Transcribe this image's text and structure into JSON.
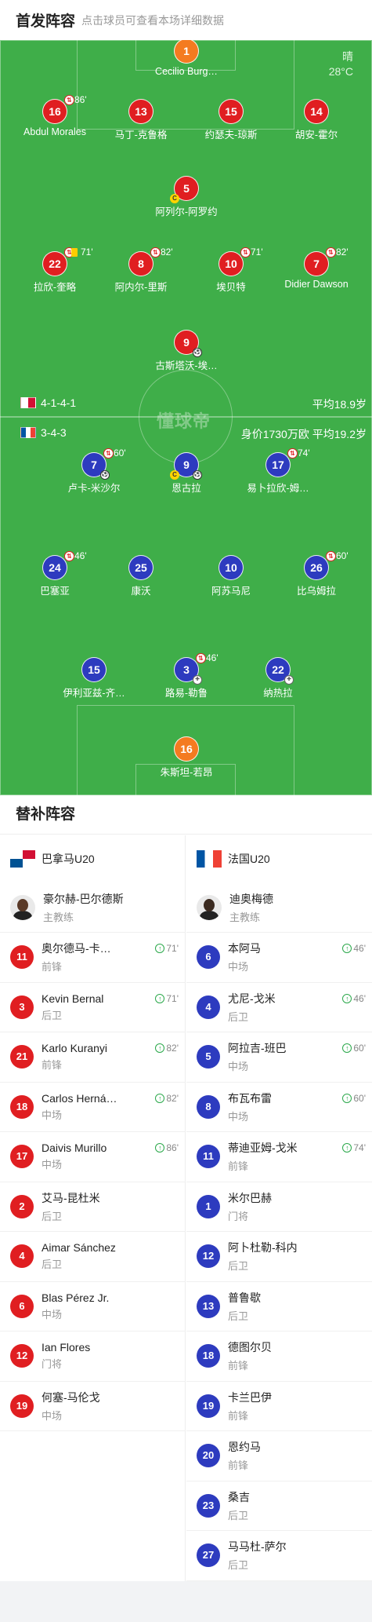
{
  "header": {
    "title": "首发阵容",
    "hint": "点击球员可查看本场详细数据"
  },
  "weather": {
    "condition": "晴",
    "temperature": "28°C"
  },
  "watermark": "懂球帝",
  "home_team": {
    "formation": "4-1-4-1",
    "info": "平均18.9岁",
    "players": [
      {
        "number": "1",
        "name": "Cecilio Burg…",
        "color": "orange"
      },
      {
        "number": "16",
        "name": "Abdul Morales",
        "sub": "86'",
        "color": "red"
      },
      {
        "number": "13",
        "name": "马丁-克鲁格",
        "color": "red"
      },
      {
        "number": "15",
        "name": "约瑟夫-琼斯",
        "color": "red"
      },
      {
        "number": "14",
        "name": "胡安-霍尔",
        "color": "red"
      },
      {
        "number": "5",
        "name": "阿列尔-阿罗约",
        "color": "red",
        "captain": "C"
      },
      {
        "number": "22",
        "name": "拉欣-奎略",
        "sub": "71'",
        "color": "red",
        "card": "yellow"
      },
      {
        "number": "8",
        "name": "阿内尔-里斯",
        "sub": "82'",
        "color": "red"
      },
      {
        "number": "10",
        "name": "埃贝特",
        "sub": "71'",
        "color": "red"
      },
      {
        "number": "7",
        "name": "Didier Dawson",
        "sub": "82'",
        "color": "red"
      },
      {
        "number": "9",
        "name": "古斯塔沃-埃…",
        "color": "red",
        "goal": "⚽"
      }
    ]
  },
  "away_team": {
    "formation": "3-4-3",
    "info": "身价1730万欧 平均19.2岁",
    "players": [
      {
        "number": "7",
        "name": "卢卡-米沙尔",
        "sub": "60'",
        "color": "blue",
        "goal": "⚽"
      },
      {
        "number": "9",
        "name": "恩古拉",
        "color": "blue",
        "captain": "C",
        "goal": "⚽"
      },
      {
        "number": "17",
        "name": "易卜拉欣-姆…",
        "sub": "74'",
        "color": "blue"
      },
      {
        "number": "24",
        "name": "巴塞亚",
        "sub": "46'",
        "color": "blue"
      },
      {
        "number": "25",
        "name": "康沃",
        "color": "blue"
      },
      {
        "number": "10",
        "name": "阿苏马尼",
        "color": "blue"
      },
      {
        "number": "26",
        "name": "比乌姆拉",
        "sub": "60'",
        "color": "blue"
      },
      {
        "number": "15",
        "name": "伊利亚兹-齐…",
        "color": "blue"
      },
      {
        "number": "3",
        "name": "路易-勒鲁",
        "sub": "46'",
        "color": "blue",
        "hurt": "✚"
      },
      {
        "number": "22",
        "name": "纳热拉",
        "color": "blue",
        "hurt": "✚"
      },
      {
        "number": "16",
        "name": "朱斯坦-若昂",
        "color": "orange"
      }
    ]
  },
  "subs": {
    "title": "替补阵容",
    "home": {
      "team_name": "巴拿马U20",
      "coach": {
        "name": "豪尔赫-巴尔德斯",
        "role": "主教练"
      },
      "players": [
        {
          "number": "11",
          "name": "奥尔德马-卡…",
          "role": "前锋",
          "in": "71'"
        },
        {
          "number": "3",
          "name": "Kevin Bernal",
          "role": "后卫",
          "in": "71'"
        },
        {
          "number": "21",
          "name": "Karlo Kuranyi",
          "role": "前锋",
          "in": "82'"
        },
        {
          "number": "18",
          "name": "Carlos Herná…",
          "role": "中场",
          "in": "82'"
        },
        {
          "number": "17",
          "name": "Daivis Murillo",
          "role": "中场",
          "in": "86'"
        },
        {
          "number": "2",
          "name": "艾马-昆杜米",
          "role": "后卫"
        },
        {
          "number": "4",
          "name": "Aimar Sánchez",
          "role": "后卫"
        },
        {
          "number": "6",
          "name": "Blas Pérez Jr.",
          "role": "中场"
        },
        {
          "number": "12",
          "name": "Ian Flores",
          "role": "门将"
        },
        {
          "number": "19",
          "name": "何塞-马伦戈",
          "role": "中场"
        }
      ]
    },
    "away": {
      "team_name": "法国U20",
      "coach": {
        "name": "迪奥梅德",
        "role": "主教练"
      },
      "players": [
        {
          "number": "6",
          "name": "本阿马",
          "role": "中场",
          "in": "46'"
        },
        {
          "number": "4",
          "name": "尤尼-戈米",
          "role": "后卫",
          "in": "46'"
        },
        {
          "number": "5",
          "name": "阿拉吉-班巴",
          "role": "中场",
          "in": "60'"
        },
        {
          "number": "8",
          "name": "布瓦布雷",
          "role": "中场",
          "in": "60'"
        },
        {
          "number": "11",
          "name": "蒂迪亚姆-戈米",
          "role": "前锋",
          "in": "74'"
        },
        {
          "number": "1",
          "name": "米尔巴赫",
          "role": "门将"
        },
        {
          "number": "12",
          "name": "阿卜杜勒-科内",
          "role": "后卫"
        },
        {
          "number": "13",
          "name": "普鲁歇",
          "role": "后卫"
        },
        {
          "number": "18",
          "name": "德图尔贝",
          "role": "前锋"
        },
        {
          "number": "19",
          "name": "卡兰巴伊",
          "role": "前锋"
        },
        {
          "number": "20",
          "name": "恩约马",
          "role": "前锋"
        },
        {
          "number": "23",
          "name": "桑吉",
          "role": "后卫"
        },
        {
          "number": "27",
          "name": "马马杜-萨尔",
          "role": "后卫"
        }
      ]
    }
  }
}
